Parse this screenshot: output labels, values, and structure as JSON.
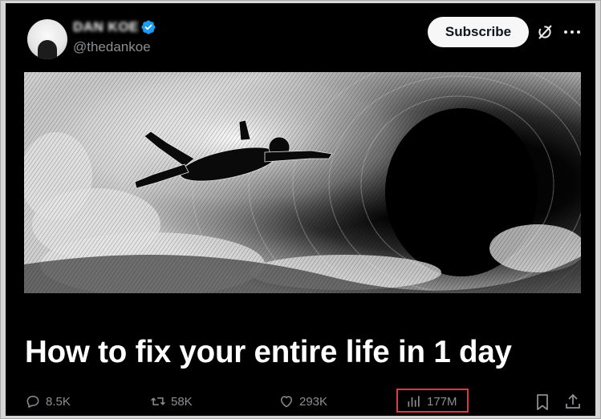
{
  "post": {
    "author_name": "DAN KOE",
    "handle": "@thedankoe",
    "subscribe_label": "Subscribe",
    "headline": "How to fix your entire life in 1 day",
    "media_icon": "engraving-astronaut-falling-into-vortex"
  },
  "actions": {
    "replies": "8.5K",
    "reposts": "58K",
    "likes": "293K",
    "views": "177M"
  },
  "colors": {
    "background": "#000000",
    "muted_text": "#8b8f94",
    "verified_blue": "#1d9bf0",
    "highlight_box": "#e0363d"
  }
}
